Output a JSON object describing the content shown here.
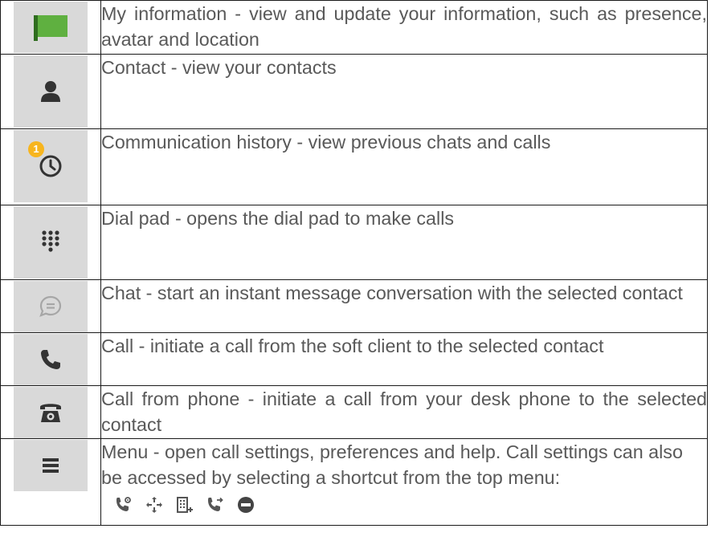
{
  "rows": [
    {
      "icon": "green-flag-icon",
      "text": "My information - view and update your information, such as presence, avatar and location"
    },
    {
      "icon": "contact-person-icon",
      "text": "Contact - view your contacts"
    },
    {
      "icon": "history-clock-icon",
      "badge": "1",
      "text": "Communication history - view previous chats and calls"
    },
    {
      "icon": "dial-pad-icon",
      "text": "Dial pad - opens the dial pad to make calls"
    },
    {
      "icon": "chat-bubble-icon",
      "text": "Chat - start an instant message conversation with the selected contact"
    },
    {
      "icon": "phone-handset-icon",
      "text": "Call - initiate a call from the soft client to the selected contact"
    },
    {
      "icon": "desk-phone-icon",
      "text": "Call from phone - initiate a call from your desk phone to the selected contact"
    },
    {
      "icon": "menu-hamburger-icon",
      "text": "Menu - open call settings, preferences and help. Call settings can also be accessed by selecting a shortcut from the top menu:"
    }
  ],
  "shortcut_icons": [
    "call-settings-icon",
    "call-forward-icon",
    "building-add-icon",
    "call-transfer-icon",
    "do-not-disturb-icon"
  ],
  "colors": {
    "text": "#595959",
    "icon": "#333333",
    "icon_bg": "#d9d9d9",
    "flag": "#5fb040",
    "badge": "#f7b51e",
    "border": "#1a1a1a"
  }
}
